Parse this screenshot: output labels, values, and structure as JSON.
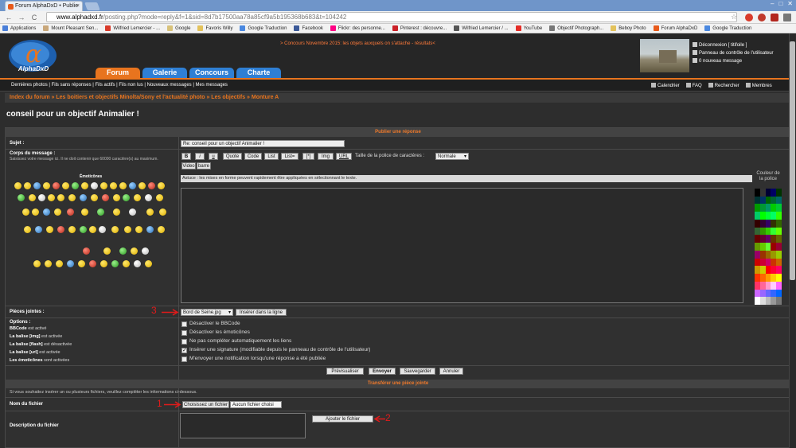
{
  "browser": {
    "tab_title": "Forum AlphaDxD • Publie",
    "tab_close": "×",
    "url_host": "www.alphadxd.fr",
    "url_rest": "/posting.php?mode=reply&f=1&sid=8d7b17500aa78a85cf9a5b195368b683&t=104242",
    "window_controls": [
      "–",
      "□",
      "✕"
    ],
    "nav_back": "←",
    "nav_forward": "→",
    "nav_reload": "C",
    "nav_star": "☆",
    "bookmarks": [
      {
        "label": "Applications",
        "color": "#4a7fd9"
      },
      {
        "label": "Mount Pleasant Sen...",
        "color": "#c9a77a"
      },
      {
        "label": "Wilfried Lemercier - ...",
        "color": "#d93b2b"
      },
      {
        "label": "Google",
        "color": "#d8c27a"
      },
      {
        "label": "Favoris Willy",
        "color": "#e3c25b"
      },
      {
        "label": "Google Traduction",
        "color": "#4a88e0"
      },
      {
        "label": "Facebook",
        "color": "#3b5998"
      },
      {
        "label": "Flickr: des personne...",
        "color": "#ff0084"
      },
      {
        "label": "Pinterest : découvre...",
        "color": "#cb2027"
      },
      {
        "label": "Wilfried Lemercier / ...",
        "color": "#555555"
      },
      {
        "label": "YouTube",
        "color": "#e52d27"
      },
      {
        "label": "Objectif Photograph...",
        "color": "#777777"
      },
      {
        "label": "Beboy Photo",
        "color": "#e3c25b"
      },
      {
        "label": "Forum AlphaDxD",
        "color": "#e85a1b"
      },
      {
        "label": "Google Traduction",
        "color": "#4a88e0"
      }
    ]
  },
  "site": {
    "logo_text": "AlphaDxD",
    "promo": "> Concours Novembre 2015: les objets auxquels on s'attache - résultats<",
    "tabs": [
      {
        "label": "Forum",
        "color": "#e8741e"
      },
      {
        "label": "Galerie",
        "color": "#2f7fd4"
      },
      {
        "label": "Concours",
        "color": "#2f7fd4"
      },
      {
        "label": "Charte",
        "color": "#2f7fd4"
      }
    ],
    "user_links": [
      "Déconnexion [ titifoile ]",
      "Panneau de contrôle de l'utilisateur",
      "0 nouveau message"
    ],
    "subnav_left": "Dernières photos | Fils sans réponses | Fils actifs | Fils non lus | Nouveaux messages | Mes messages",
    "subnav_right": [
      "Calendrier",
      "FAQ",
      "Rechercher",
      "Membres"
    ],
    "breadcrumb": "Index du forum » Les boitiers et objectifs Minolta/Sony et l'actualité photo » Les objectifs » Monture A",
    "page_title": "conseil pour un objectif Animalier !"
  },
  "form": {
    "section_post": "Publier une réponse",
    "subject_label": "Sujet :",
    "subject_value": "Re: conseil pour un objectif Animalier !",
    "body_label": "Corps du message :",
    "body_hint": "Saisissez votre message ici. Il ne doit contenir que 60000 caractère(s) au maximum.",
    "emoticons_label": "Émoticônes",
    "format_buttons": [
      "B",
      "i",
      "u",
      "Quote",
      "Code",
      "List",
      "List=",
      "[*]",
      "Img",
      "URL"
    ],
    "font_size_label": "Taille de la police de caractères :",
    "font_size_value": "Normale",
    "extra_buttons": [
      "Video",
      "barre"
    ],
    "tip": "Astuce : les mises en forme peuvent rapidement être appliquées en sélectionnant le texte.",
    "color_label": "Couleur de la police",
    "attachments_label": "Pièces jointes :",
    "attachment_file": "Bord de Seine.jpg",
    "insert_inline": "Insérer dans la ligne",
    "options_label": "Options :",
    "option_info": [
      {
        "name": "BBCode",
        "state": "est activé"
      },
      {
        "name": "La balise [img]",
        "state": "est activée"
      },
      {
        "name": "La balise [flash]",
        "state": "est désactivée"
      },
      {
        "name": "La balise [url]",
        "state": "est activée"
      },
      {
        "name": "Les émoticônes",
        "state": "sont activées"
      }
    ],
    "checkboxes": [
      {
        "label": "Désactiver le BBCode",
        "checked": false
      },
      {
        "label": "Désactiver les émoticônes",
        "checked": false
      },
      {
        "label": "Ne pas compléter automatiquement les liens",
        "checked": false
      },
      {
        "label": "Insérer une signature (modifiable depuis le panneau de contrôle de l'utilisateur)",
        "checked": true
      },
      {
        "label": "M'envoyer une notification lorsqu'une réponse a été publiée",
        "checked": false
      }
    ],
    "actions": [
      "Prévisualiser",
      "Envoyer",
      "Sauvegarder",
      "Annuler"
    ],
    "section_attach": "Transférer une pièce jointe",
    "attach_hint": "Si vous souhaitez insérer un ou plusieurs fichiers, veuillez compléter les informations ci-dessous.",
    "filename_label": "Nom du fichier",
    "choose_file": "Choisissez un fichier",
    "no_file": "Aucun fichier choisi",
    "description_label": "Description du fichier",
    "add_file": "Ajouter le fichier"
  },
  "annotations": [
    "3",
    "1",
    "2"
  ],
  "palette_colors": [
    "#000000",
    "#333333",
    "#000033",
    "#000066",
    "#003300",
    "#003333",
    "#003366",
    "#006600",
    "#006633",
    "#006666",
    "#009900",
    "#009933",
    "#009966",
    "#00cc00",
    "#00cc33",
    "#00cc66",
    "#00ff00",
    "#00ff33",
    "#00ff66",
    "#33ff00",
    "#330000",
    "#330033",
    "#330066",
    "#333300",
    "#336600",
    "#336633",
    "#339900",
    "#33cc00",
    "#33ff33",
    "#66ff00",
    "#660000",
    "#660033",
    "#660066",
    "#663300",
    "#666600",
    "#669900",
    "#66cc00",
    "#66ff33",
    "#990000",
    "#990033",
    "#990066",
    "#993300",
    "#996600",
    "#999900",
    "#99cc00",
    "#cc0000",
    "#cc0033",
    "#cc0066",
    "#cc3300",
    "#cc6600",
    "#cc9900",
    "#cccc00",
    "#ff0000",
    "#ff0033",
    "#ff0066",
    "#ff3300",
    "#ff6600",
    "#ff9900",
    "#ffcc00",
    "#ffff00",
    "#ff3366",
    "#ff6699",
    "#ff99cc",
    "#ffccff",
    "#ff66ff",
    "#cc66ff",
    "#9966ff",
    "#6666ff",
    "#3366ff",
    "#0066ff",
    "#ffffff",
    "#dddddd",
    "#bbbbbb",
    "#999999",
    "#777777"
  ]
}
